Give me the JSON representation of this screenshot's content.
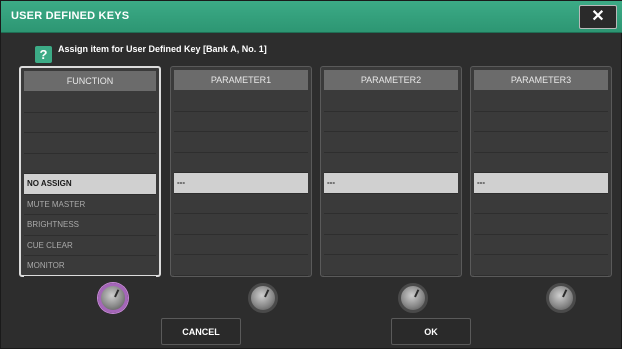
{
  "window": {
    "title": "USER DEFINED KEYS",
    "close_label": "✕"
  },
  "prompt": {
    "help_glyph": "?",
    "text": "Assign item for User Defined Key [Bank A, No. 1]"
  },
  "columns": [
    {
      "header": "FUNCTION",
      "rows": [
        "",
        "",
        "",
        "",
        "NO ASSIGN",
        "MUTE MASTER",
        "BRIGHTNESS",
        "CUE CLEAR",
        "MONITOR"
      ],
      "active_row": 4
    },
    {
      "header": "PARAMETER1",
      "rows": [
        "",
        "",
        "",
        "",
        "---",
        "",
        "",
        "",
        ""
      ],
      "active_row": 4
    },
    {
      "header": "PARAMETER2",
      "rows": [
        "",
        "",
        "",
        "",
        "---",
        "",
        "",
        "",
        ""
      ],
      "active_row": 4
    },
    {
      "header": "PARAMETER3",
      "rows": [
        "",
        "",
        "",
        "",
        "---",
        "",
        "",
        "",
        ""
      ],
      "active_row": 4
    }
  ],
  "buttons": {
    "cancel": "CANCEL",
    "ok": "OK"
  },
  "colors": {
    "title_bar": "#3cab86",
    "focused_knob": "#a566b9",
    "selected_row": "#d0d0d0"
  }
}
